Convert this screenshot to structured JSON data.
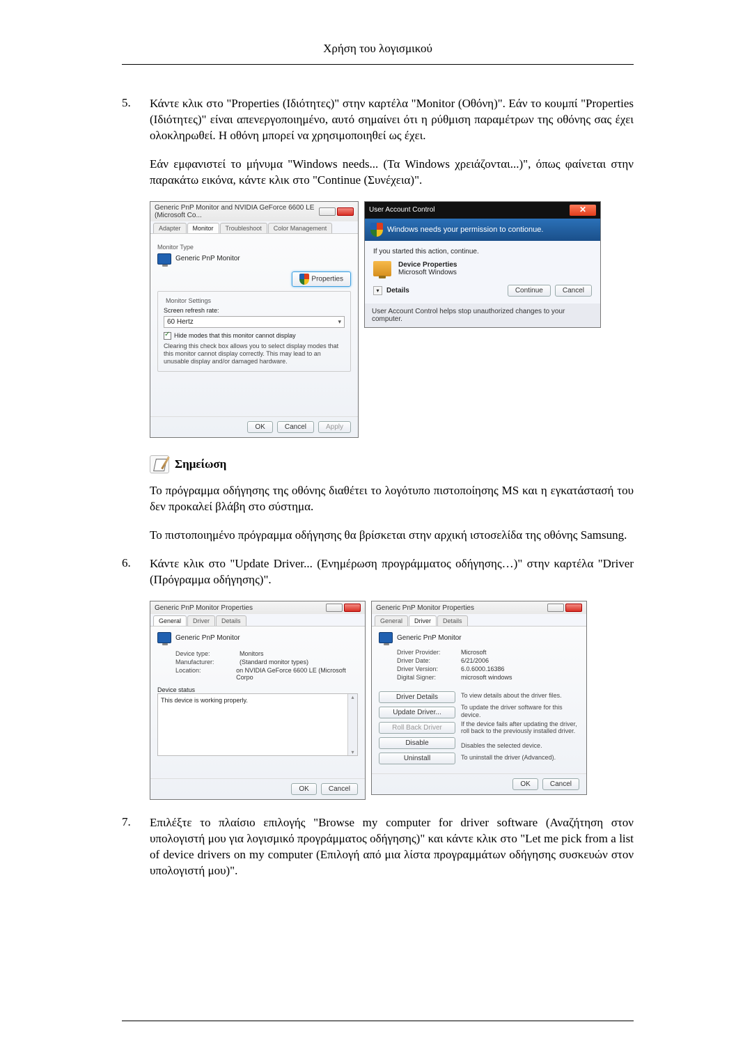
{
  "header": "Χρήση του λογισμικού",
  "items": {
    "5": {
      "num": "5.",
      "text": "Κάντε κλικ στο \"Properties (Ιδιότητες)\" στην καρτέλα \"Monitor (Οθόνη)\". Εάν το κουμπί \"Properties (Ιδιότητες)\" είναι απενεργοποιημένο, αυτό σημαίνει ότι η ρύθμιση παραμέτρων της οθόνης σας έχει ολοκληρωθεί. Η οθόνη μπορεί να χρησιμοποιηθεί ως έχει.",
      "text2": "Εάν εμφανιστεί το μήνυμα \"Windows needs... (Τα Windows χρειάζονται...)\", όπως φαίνεται στην παρακάτω εικόνα, κάντε κλικ στο \"Continue (Συνέχεια)\"."
    },
    "6": {
      "num": "6.",
      "text": "Κάντε κλικ στο \"Update Driver... (Ενημέρωση προγράμματος οδήγησης…)\" στην καρτέλα \"Driver (Πρόγραμμα οδήγησης)\"."
    },
    "7": {
      "num": "7.",
      "text": "Επιλέξτε το πλαίσιο επιλογής \"Browse my computer for driver software (Αναζήτηση στον υπολογιστή μου για λογισμικό προγράμματος οδήγησης)\" και κάντε κλικ στο \"Let me pick from a list of device drivers on my computer (Επιλογή από μια λίστα προγραμμάτων οδήγησης συσκευών στον υπολογιστή μου)\"."
    }
  },
  "note": {
    "label": "Σημείωση",
    "p1": "Το πρόγραμμα οδήγησης της οθόνης διαθέτει το λογότυπο πιστοποίησης MS και η εγκατάστασή του δεν προκαλεί βλάβη στο σύστημα.",
    "p2": "Το πιστοποιημένο πρόγραμμα οδήγησης θα βρίσκεται στην αρχική ιστοσελίδα της οθόνης Samsung."
  },
  "dlg1": {
    "title": "Generic PnP Monitor and NVIDIA GeForce 6600 LE (Microsoft Co...",
    "tabs": [
      "Adapter",
      "Monitor",
      "Troubleshoot",
      "Color Management"
    ],
    "monitorTypeLabel": "Monitor Type",
    "monitorTypeValue": "Generic PnP Monitor",
    "propertiesBtn": "Properties",
    "settingsLabel": "Monitor Settings",
    "refreshLabel": "Screen refresh rate:",
    "refreshValue": "60 Hertz",
    "hideLabel": "Hide modes that this monitor cannot display",
    "hideDesc": "Clearing this check box allows you to select display modes that this monitor cannot display correctly. This may lead to an unusable display and/or damaged hardware.",
    "ok": "OK",
    "cancel": "Cancel",
    "apply": "Apply"
  },
  "uac": {
    "title": "User Account Control",
    "blueBar": "Windows needs your permission to contionue.",
    "subPrompt": "If you started this action, continue.",
    "devProps": "Device Properties",
    "msWin": "Microsoft Windows",
    "details": "Details",
    "continue": "Continue",
    "cancel": "Cancel",
    "footer": "User Account Control helps stop unauthorized changes to your computer."
  },
  "dlg2a": {
    "title": "Generic PnP Monitor Properties",
    "tabs": [
      "General",
      "Driver",
      "Details"
    ],
    "icon": "Generic PnP Monitor",
    "rows": {
      "deviceType": {
        "k": "Device type:",
        "v": "Monitors"
      },
      "manufacturer": {
        "k": "Manufacturer:",
        "v": "(Standard monitor types)"
      },
      "location": {
        "k": "Location:",
        "v": "on NVIDIA GeForce 6600 LE (Microsoft Corpo"
      }
    },
    "statusLabel": "Device status",
    "statusText": "This device is working properly.",
    "ok": "OK",
    "cancel": "Cancel"
  },
  "dlg2b": {
    "title": "Generic PnP Monitor Properties",
    "tabs": [
      "General",
      "Driver",
      "Details"
    ],
    "icon": "Generic PnP Monitor",
    "rows": {
      "provider": {
        "k": "Driver Provider:",
        "v": "Microsoft"
      },
      "date": {
        "k": "Driver Date:",
        "v": "6/21/2006"
      },
      "version": {
        "k": "Driver Version:",
        "v": "6.0.6000.16386"
      },
      "signer": {
        "k": "Digital Signer:",
        "v": "microsoft windows"
      }
    },
    "btns": {
      "details": {
        "label": "Driver Details",
        "desc": "To view details about the driver files."
      },
      "update": {
        "label": "Update Driver...",
        "desc": "To update the driver software for this device."
      },
      "rollback": {
        "label": "Roll Back Driver",
        "desc": "If the device fails after updating the driver, roll back to the previously installed driver."
      },
      "disable": {
        "label": "Disable",
        "desc": "Disables the selected device."
      },
      "uninstall": {
        "label": "Uninstall",
        "desc": "To uninstall the driver (Advanced)."
      }
    },
    "ok": "OK",
    "cancel": "Cancel"
  }
}
